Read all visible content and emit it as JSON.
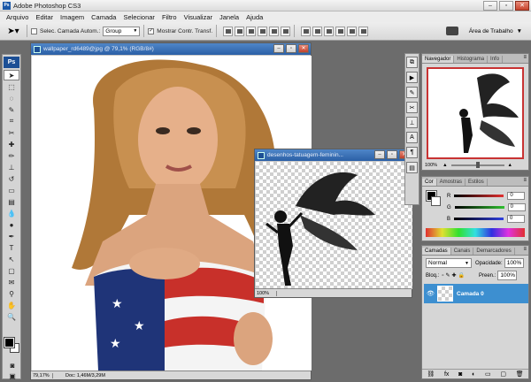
{
  "app": {
    "title": "Adobe Photoshop CS3",
    "logo": "Ps"
  },
  "menu": [
    "Arquivo",
    "Editar",
    "Imagem",
    "Camada",
    "Selecionar",
    "Filtro",
    "Visualizar",
    "Janela",
    "Ajuda"
  ],
  "options": {
    "auto_select_label": "Selec. Camada Autom.:",
    "auto_select_value": "Group",
    "show_transform_label": "Mostrar Contr. Transf.",
    "workspace_label": "Área de Trabalho"
  },
  "doc1": {
    "title": "wallpaper_rd6489@jpg @ 79,1% (RGB/8#)",
    "zoom": "79,17%",
    "info": "Doc: 1,46M/3,29M"
  },
  "doc2": {
    "title": "desenhos-tatuagem-feminin...",
    "zoom": "100%"
  },
  "navigator": {
    "tabs": [
      "Navegador",
      "Histograma",
      "Info"
    ],
    "zoom": "100%"
  },
  "color_panel": {
    "tabs": [
      "Cor",
      "Amostras",
      "Estilos"
    ],
    "channels": [
      {
        "label": "R",
        "value": "0",
        "color": "#d43030"
      },
      {
        "label": "G",
        "value": "0",
        "color": "#30b030"
      },
      {
        "label": "B",
        "value": "0",
        "color": "#3040d0"
      }
    ]
  },
  "layers_panel": {
    "tabs": [
      "Camadas",
      "Canais",
      "Demarcadores"
    ],
    "blend_mode": "Normal",
    "opacity_label": "Opacidade:",
    "opacity_value": "100%",
    "lock_label": "Bloq.:",
    "fill_label": "Preen.:",
    "fill_value": "100%",
    "layers": [
      {
        "name": "Camada 0"
      }
    ]
  },
  "colors": {
    "accent": "#3d8fd0",
    "title_blue": "#2b5fa6",
    "nav_frame": "#c83232"
  }
}
